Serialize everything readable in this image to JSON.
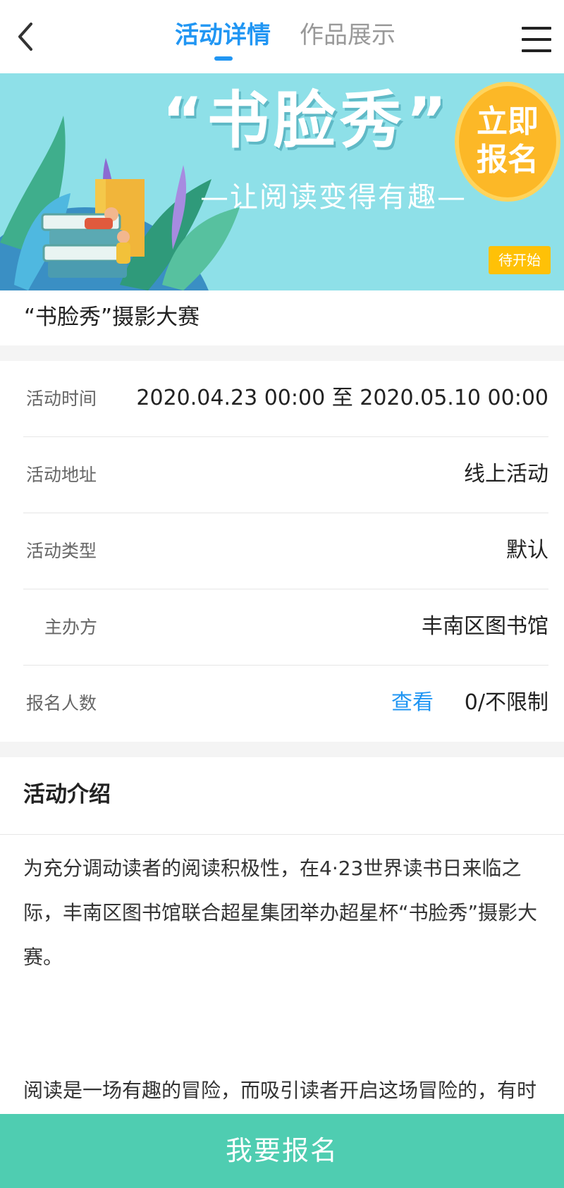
{
  "header": {
    "tabs": [
      {
        "label": "活动详情",
        "active": true
      },
      {
        "label": "作品展示",
        "active": false
      }
    ]
  },
  "banner": {
    "title": "“书脸秀”",
    "subtitle": "—让阅读变得有趣—",
    "signup_line1": "立即",
    "signup_line2": "报名",
    "status": "待开始"
  },
  "activity": {
    "title": "“书脸秀”摄影大赛",
    "rows": [
      {
        "label": "活动时间",
        "value": "2020.04.23 00:00 至 2020.05.10 00:00"
      },
      {
        "label": "活动地址",
        "value": "线上活动"
      },
      {
        "label": "活动类型",
        "value": "默认"
      },
      {
        "label": "主办方",
        "value": "丰南区图书馆"
      },
      {
        "label": "报名人数",
        "value": "0/不限制",
        "link": "查看"
      }
    ]
  },
  "intro": {
    "heading": "活动介绍",
    "paragraph1": "为充分调动读者的阅读积极性，在4·23世界读书日来临之际，丰南区图书馆联合超星集团举办超星杯“书脸秀”摄影大赛。",
    "paragraph2": "阅读是一场有趣的冒险，而吸引读者开启这场冒险的，有时也许是一个有意思的封面。“书脸”是一种新兴的图"
  },
  "footer": {
    "signup_button": "我要报名"
  },
  "colors": {
    "accent": "#2196f3",
    "footer_button": "#4fcdb1",
    "status_badge": "#ffc107",
    "banner_bg": "#8ee0e8"
  }
}
